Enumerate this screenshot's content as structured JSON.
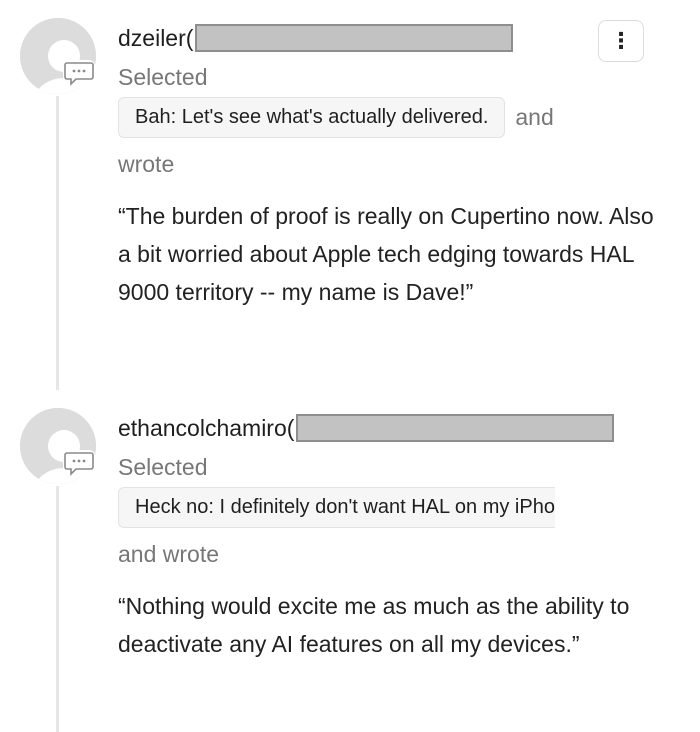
{
  "menu": {
    "icon": "more-vertical-icon",
    "glyph": "⋮"
  },
  "comments": [
    {
      "username": "dzeiler(",
      "selected_label": "Selected",
      "quote": "Bah: Let's see what's actually delivered.",
      "and_label": "and",
      "wrote_label": "wrote",
      "text": "“The burden of proof is really on Cupertino now. Also a bit worried about Apple tech edging towards HAL 9000 territory -- my name is Dave!”"
    },
    {
      "username": "ethancolchamiro(",
      "selected_label": "Selected",
      "quote": "Heck no: I definitely don't want HAL on my iPho",
      "and_wrote_label": "and wrote",
      "text": "“Nothing would excite me as much as the ability to deactivate any AI features on all my devices.”"
    }
  ],
  "colors": {
    "avatar_bg": "#dcdcdc",
    "avatar_figure": "#ffffff",
    "redaction_fill": "#c2c2c2",
    "redaction_border": "#8e8e8e",
    "muted_text": "#777777",
    "chip_bg": "#f6f6f6",
    "thread_line": "#e6e6e6"
  }
}
